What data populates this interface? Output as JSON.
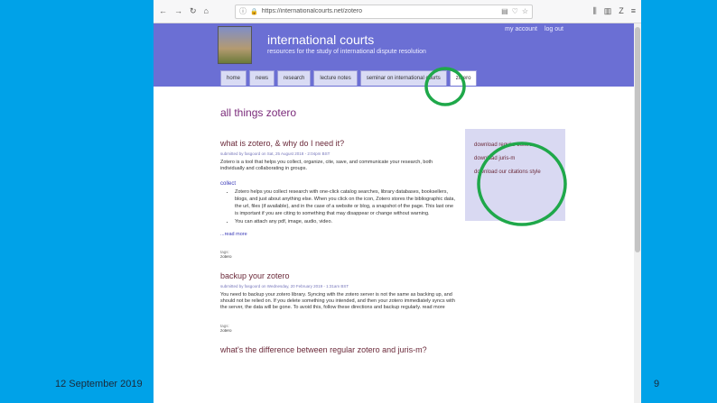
{
  "slide": {
    "date": "12 September 2019",
    "page_number": "9"
  },
  "browser": {
    "url": "https://internationalcourts.net/zotero"
  },
  "site": {
    "title": "international courts",
    "tagline": "resources for the study of international dispute resolution",
    "account_links": [
      "my account",
      "log out"
    ],
    "tabs": [
      "home",
      "news",
      "research",
      "lecture notes",
      "seminar on international courts",
      "zotero"
    ]
  },
  "page": {
    "title": "all things zotero"
  },
  "articles": [
    {
      "title": "what is zotero, & why do I need it?",
      "submitted": "submitted by fasgoord on Sat, 25 August 2018 - 2:04pm BST",
      "intro": "Zotero is a tool that helps you collect, organize, cite, save, and communicate your research, both individually and collaborating in groups.",
      "section": "collect",
      "bullets": [
        "Zotero helps you collect research with one-click catalog searches, library databases, booksellers, blogs, and just about anything else. When you click on the icon, Zotero stores the bibliographic data, the url, files (if available), and in the case of a website or blog, a snapshot of the page. This last one is important if you are citing to something that may disappear or change without warning.",
        "You can attach any pdf, image, audio, video."
      ],
      "read_more": "...read more",
      "tags_label": "tags:",
      "tag": "zotero"
    },
    {
      "title": "backup your zotero",
      "submitted": "submitted by fasgoord on Wednesday, 20 February 2019 - 1:31am BST",
      "intro": "You need to backup your zotero library. Syncing with the zotero server is not the same as backing up, and should not be relied on. If you delete something you intended, and then your zotero immediately syncs with the server, the data will be gone. To avoid this, follow these directions and backup regularly. read more",
      "tags_label": "tags:",
      "tag": "zotero"
    },
    {
      "title": "what's the difference between regular zotero and juris-m?"
    }
  ],
  "sidebar": {
    "links": [
      "download regular zotero",
      "download juris-m",
      "download our citations style"
    ]
  },
  "annotation_color": "#1fa84a"
}
